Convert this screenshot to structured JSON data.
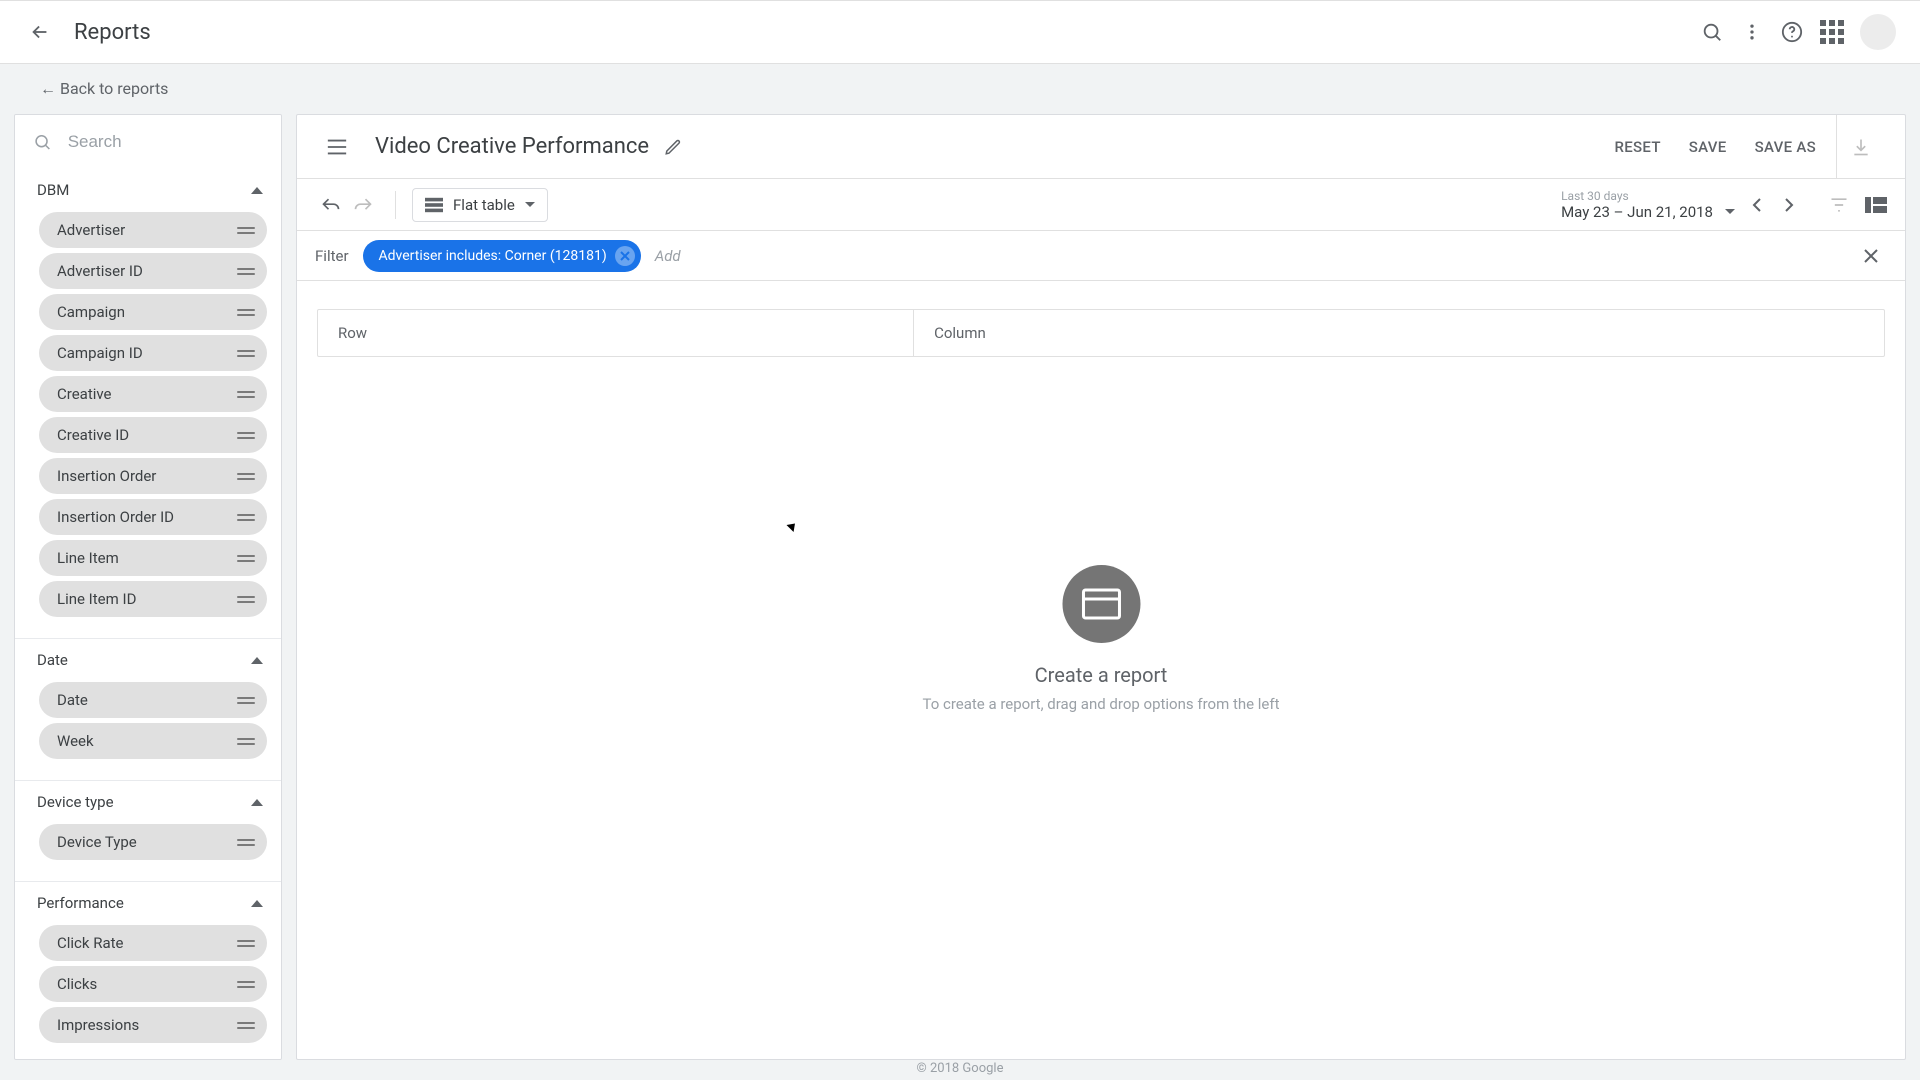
{
  "appbar": {
    "title": "Reports"
  },
  "back_link": "←  Back to reports",
  "search": {
    "placeholder": "Search"
  },
  "sidebar_groups": [
    {
      "name": "DBM",
      "items": [
        "Advertiser",
        "Advertiser ID",
        "Campaign",
        "Campaign ID",
        "Creative",
        "Creative ID",
        "Insertion Order",
        "Insertion Order ID",
        "Line Item",
        "Line Item ID"
      ]
    },
    {
      "name": "Date",
      "items": [
        "Date",
        "Week"
      ]
    },
    {
      "name": "Device type",
      "items": [
        "Device Type"
      ]
    },
    {
      "name": "Performance",
      "items": [
        "Click Rate",
        "Clicks",
        "Impressions"
      ]
    }
  ],
  "report": {
    "title": "Video Creative Performance",
    "reset": "RESET",
    "save": "SAVE",
    "save_as": "SAVE AS",
    "table_type": "Flat table",
    "date_label": "Last 30 days",
    "date_range": "May 23 – Jun 21, 2018"
  },
  "filter": {
    "label": "Filter",
    "chip": "Advertiser includes: Corner (128181)",
    "add": "Add"
  },
  "dropzone": {
    "row": "Row",
    "column": "Column"
  },
  "empty": {
    "title": "Create a report",
    "subtitle": "To create a report, drag and drop options from the left"
  },
  "footer": "© 2018 Google"
}
